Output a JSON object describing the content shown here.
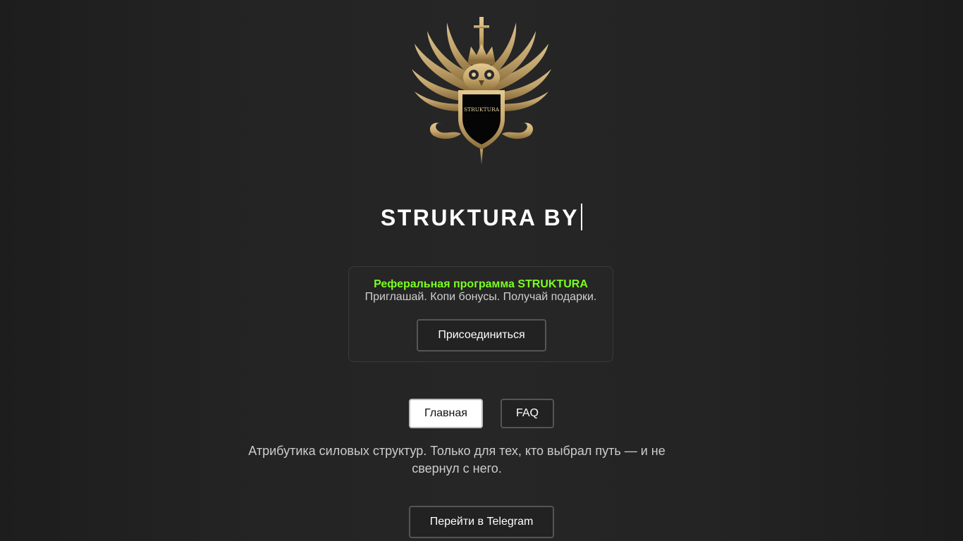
{
  "logo": {
    "icon": "owl-crest-logo",
    "shield_text": "STRUKTURA",
    "gold": "#c9a96e",
    "gold_dark": "#8a6d3b"
  },
  "header": {
    "title": "STRUKTURA BY"
  },
  "referral": {
    "title": "Реферальная программа STRUKTURA",
    "subtitle": "Приглашай. Копи бонусы. Получай подарки.",
    "join_label": "Присоединиться",
    "accent_color": "#7cff1f"
  },
  "nav": {
    "home_label": "Главная",
    "faq_label": "FAQ"
  },
  "main": {
    "tagline": "Атрибутика силовых структур. Только для тех, кто выбрал путь — и не свернул с него.",
    "telegram_label": "Перейти в Telegram"
  },
  "colors": {
    "background": "#232323",
    "text": "#ffffff",
    "muted_text": "#cccccc"
  }
}
